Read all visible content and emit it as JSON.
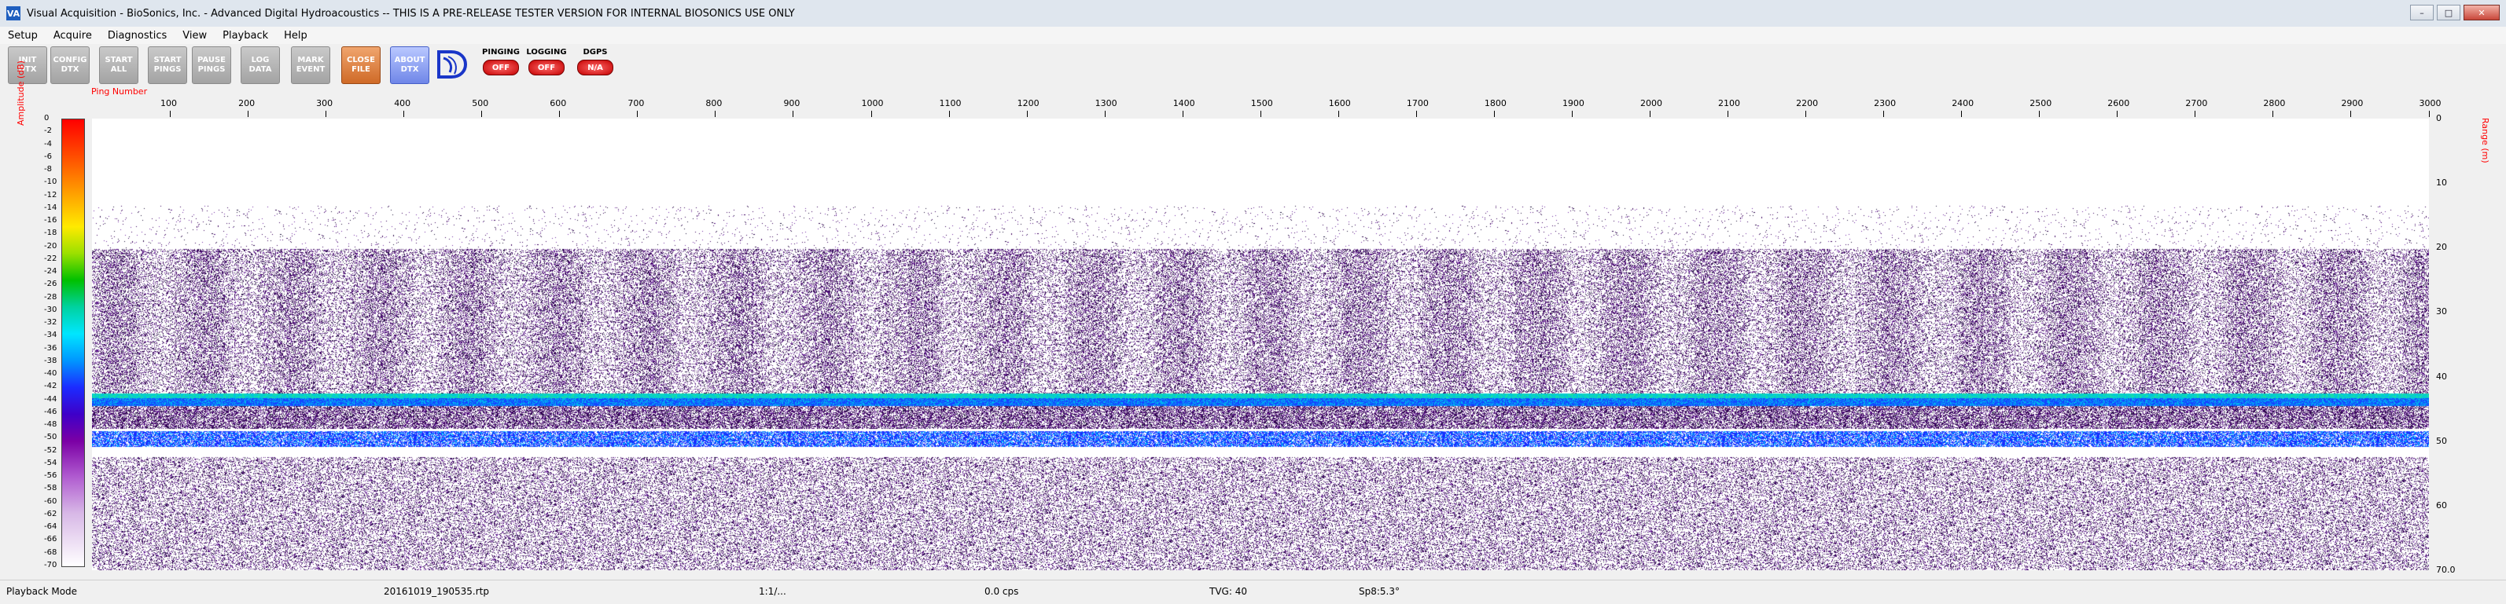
{
  "titlebar": {
    "app_icon": "VA",
    "title": "Visual Acquisition  -  BioSonics, Inc.  -  Advanced Digital Hydroacoustics  -- THIS IS A PRE-RELEASE TESTER VERSION FOR INTERNAL BIOSONICS USE ONLY",
    "minimize": "–",
    "maximize": "□",
    "close": "✕"
  },
  "menu": [
    "Setup",
    "Acquire",
    "Diagnostics",
    "View",
    "Playback",
    "Help"
  ],
  "toolbar": {
    "buttons": [
      {
        "label": "INIT\nDTX"
      },
      {
        "label": "CONFIG\nDTX"
      },
      {
        "label": "START\nALL"
      },
      {
        "label": "START\nPINGS"
      },
      {
        "label": "PAUSE\nPINGS"
      },
      {
        "label": "LOG\nDATA"
      },
      {
        "label": "MARK\nEVENT"
      },
      {
        "label": "CLOSE\nFILE"
      },
      {
        "label": "ABOUT\nDTX"
      }
    ],
    "indicators": [
      {
        "label": "PINGING",
        "state": "OFF"
      },
      {
        "label": "LOGGING",
        "state": "OFF"
      },
      {
        "label": "DGPS",
        "state": "N/A"
      }
    ]
  },
  "plot": {
    "amplitude_title": "Amplitude (dB)",
    "range_title": "Range (m)",
    "ping_title": "Ping Number",
    "colorbar_ticks": [
      "0",
      "-2",
      "-4",
      "-6",
      "-8",
      "-10",
      "-12",
      "-14",
      "-16",
      "-18",
      "-20",
      "-22",
      "-24",
      "-26",
      "-28",
      "-30",
      "-32",
      "-34",
      "-36",
      "-38",
      "-40",
      "-42",
      "-44",
      "-46",
      "-48",
      "-50",
      "-52",
      "-54",
      "-56",
      "-58",
      "-60",
      "-62",
      "-64",
      "-66",
      "-68",
      "-70"
    ],
    "ping_ticks": [
      "100",
      "200",
      "300",
      "400",
      "500",
      "600",
      "700",
      "800",
      "900",
      "1000",
      "1100",
      "1200",
      "1300",
      "1400",
      "1500",
      "1600",
      "1700",
      "1800",
      "1900",
      "2000",
      "2100",
      "2200",
      "2300",
      "2400",
      "2500",
      "2600",
      "2700",
      "2800",
      "2900",
      "3000"
    ],
    "range_ticks": [
      "0",
      "10",
      "20",
      "30",
      "40",
      "50",
      "60",
      "70.0"
    ],
    "colors": {
      "colorbar_top": "#ff0000",
      "colorbar_bottom": "#ffffff",
      "bottom_line": "#00c8d0",
      "layer_blue": "#1e3cff",
      "noise": "#4b0066"
    }
  },
  "status": {
    "mode": "Playback Mode",
    "file": "20161019_190535.rtp",
    "ratio": "1:1/...",
    "rate": "0.0 cps",
    "tvg": "TVG: 40",
    "sp": "Sp8:5.3°"
  }
}
